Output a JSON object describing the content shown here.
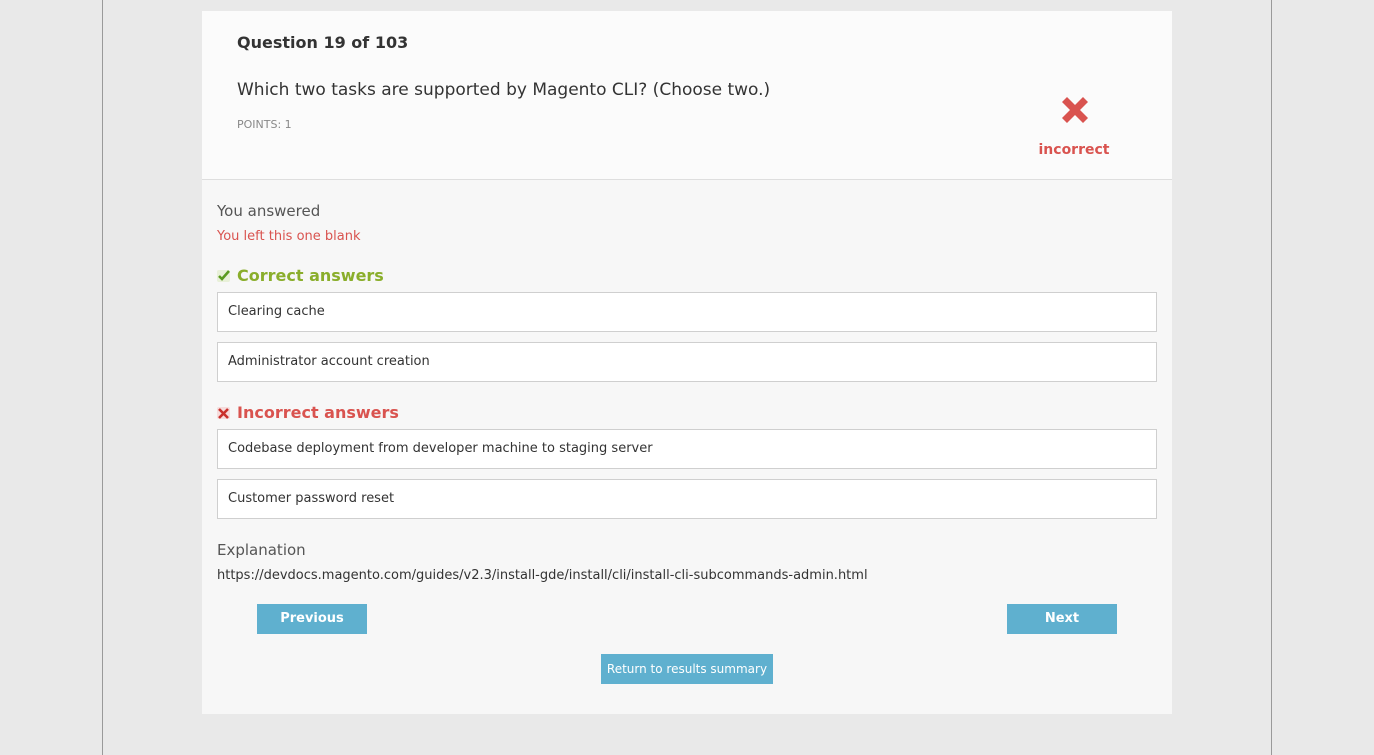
{
  "question": {
    "number_label": "Question 19 of 103",
    "text": "Which two tasks are supported by Magento CLI? (Choose two.)",
    "points_label": "POINTS: 1",
    "result_icon": "cross-icon",
    "result_label": "incorrect",
    "result_color": "#d9534f"
  },
  "you_answered": {
    "heading": "You answered",
    "note": "You left this one blank"
  },
  "correct_answers": {
    "heading": "Correct answers",
    "icon": "check-icon",
    "color": "#8aae2b",
    "items": [
      "Clearing cache",
      "Administrator account creation"
    ]
  },
  "incorrect_answers": {
    "heading": "Incorrect answers",
    "icon": "cross-icon",
    "color": "#d9534f",
    "items": [
      "Codebase deployment from developer machine to staging server",
      "Customer password reset"
    ]
  },
  "explanation": {
    "heading": "Explanation",
    "text": "https://devdocs.magento.com/guides/v2.3/install-gde/install/cli/install-cli-subcommands-admin.html"
  },
  "nav": {
    "previous_label": "Previous",
    "next_label": "Next",
    "summary_label": "Return to results summary",
    "button_color": "#5fb0cf"
  }
}
